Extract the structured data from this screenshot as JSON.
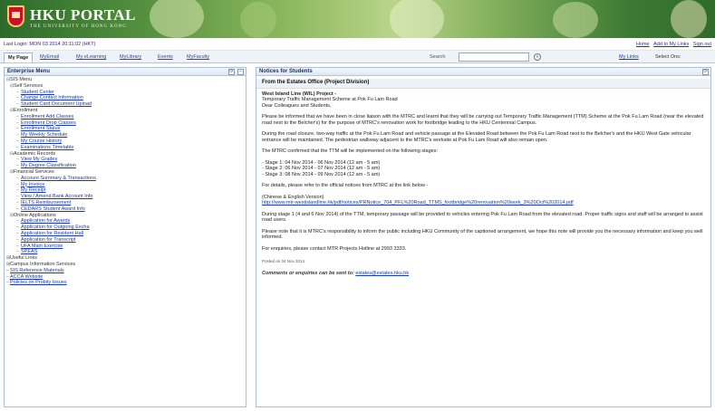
{
  "banner": {
    "title": "HKU PORTAL",
    "subtitle": "THE UNIVERSITY OF HONG KONG"
  },
  "loginbar": {
    "last_login": "Last Login: MON 03 2014 20:11:02 (HKT)",
    "links": [
      "Home",
      "Add to My Links",
      "Sign out"
    ]
  },
  "tabs": [
    "My Page",
    "MyEmail",
    "My eLearning",
    "MyLibrary",
    "Events",
    "MyFaculty"
  ],
  "search": {
    "label": "Search",
    "value": "",
    "go": "»"
  },
  "toplinks": {
    "mylinks": "My Links",
    "themes": "Select Ons:"
  },
  "left": {
    "title": "Enterprise Menu",
    "items": [
      {
        "level": 0,
        "twisty": "⊟",
        "label": "SIS Menu",
        "link": false
      },
      {
        "level": 1,
        "twisty": "⊟",
        "label": "Self Services",
        "link": false
      },
      {
        "level": 2,
        "twisty": "–",
        "label": "Student Center",
        "link": true
      },
      {
        "level": 2,
        "twisty": "–",
        "label": "Change Contact Information",
        "link": true
      },
      {
        "level": 2,
        "twisty": "–",
        "label": "Student Card Document Upload",
        "link": true
      },
      {
        "level": 1,
        "twisty": "⊟",
        "label": "Enrollment",
        "link": false
      },
      {
        "level": 2,
        "twisty": "–",
        "label": "Enrollment Add Classes",
        "link": true
      },
      {
        "level": 2,
        "twisty": "–",
        "label": "Enrollment Drop Classes",
        "link": true
      },
      {
        "level": 2,
        "twisty": "–",
        "label": "Enrollment Status",
        "link": true
      },
      {
        "level": 2,
        "twisty": "–",
        "label": "My Weekly Schedule",
        "link": true
      },
      {
        "level": 2,
        "twisty": "–",
        "label": "My Course History",
        "link": true
      },
      {
        "level": 2,
        "twisty": "–",
        "label": "Examinations Timetable",
        "link": true
      },
      {
        "level": 1,
        "twisty": "⊟",
        "label": "Academic Records",
        "link": false
      },
      {
        "level": 2,
        "twisty": "–",
        "label": "View My Grades",
        "link": true
      },
      {
        "level": 2,
        "twisty": "–",
        "label": "My Degree Classification",
        "link": true
      },
      {
        "level": 1,
        "twisty": "⊟",
        "label": "Financial Services",
        "link": false
      },
      {
        "level": 2,
        "twisty": "–",
        "label": "Account Summary & Transactions",
        "link": true
      },
      {
        "level": 2,
        "twisty": "–",
        "label": "My Invoice",
        "link": true
      },
      {
        "level": 2,
        "twisty": "–",
        "label": "My Receipt",
        "link": true
      },
      {
        "level": 2,
        "twisty": "–",
        "label": "View / Amend Bank Account Info",
        "link": true
      },
      {
        "level": 2,
        "twisty": "–",
        "label": "IELTS Reimbursement",
        "link": true
      },
      {
        "level": 2,
        "twisty": "–",
        "label": "CEDARS Student Award Info",
        "link": true
      },
      {
        "level": 1,
        "twisty": "⊟",
        "label": "Online Applications",
        "link": false
      },
      {
        "level": 2,
        "twisty": "–",
        "label": "Application for Awards",
        "link": true
      },
      {
        "level": 2,
        "twisty": "–",
        "label": "Application for Outgoing Excha",
        "link": true
      },
      {
        "level": 2,
        "twisty": "–",
        "label": "Application for Resident Hall",
        "link": true
      },
      {
        "level": 2,
        "twisty": "–",
        "label": "Application for Transcript",
        "link": true
      },
      {
        "level": 2,
        "twisty": "–",
        "label": "UFA Main Exercise",
        "link": true
      },
      {
        "level": 2,
        "twisty": "–",
        "label": "SPEAS",
        "link": true
      },
      {
        "level": 0,
        "twisty": "⊞",
        "label": "Useful Links",
        "link": false
      },
      {
        "level": 0,
        "twisty": "⊞",
        "label": "Campus Information Services",
        "link": false
      },
      {
        "level": 0,
        "twisty": "–",
        "label": "SIS Reference Materials",
        "link": true
      },
      {
        "level": 0,
        "twisty": "–",
        "label": "ACCA Website",
        "link": true
      },
      {
        "level": 0,
        "twisty": "–",
        "label": "Policies on Probity Issues",
        "link": true
      }
    ]
  },
  "right": {
    "title": "Notices for Students",
    "from": "From the Estates Office (Project Division)",
    "heading": "West Island Line (WIL) Project -",
    "subheading": "Temporary Traffic Management Scheme at Pok Fu Lam Road",
    "greeting": "Dear Colleagues and Students,",
    "para1": "Please be informed that we have been in close liaison with the MTRC and learnt that they will be carrying out Temporary Traffic Management (TTM) Scheme at the Pok Fu Lam Road (near the elevated road next to the Belcher's) for the purpose of MTRC's renovation work for footbridge leading to the HKU Centennial Campus.",
    "para2": "During the road closure, two-way traffic at the Pok Fu Lam Road and vehicle passage at the Elevated Road between the Pok Fu Lam Road next to the Belcher's and the HKU West Gate vehicular entrance will be maintained. The pedestrian walkway adjacent to the MTRC's worksite at Pok Fu Lam Road will also remain open.",
    "para3": "The MTRC confirmed that the TTM will be implemented on the following stages:",
    "stages": [
      "- Stage 1: 04 Nov 2014 - 06 Nov 2014 (12 am - 5 am)",
      "- Stage 2: 06 Nov 2014 - 07 Nov 2014 (12 am - 5 am)",
      "- Stage 3: 08 Nov 2014 - 09 Nov 2014 (12 am - 5 am)"
    ],
    "para4": "For details, please refer to the official notices from MTRC at the link below -",
    "version": "(Chinese & English Version)",
    "link": "http://www.mtr-westislandline.hk/pdf/notices/PRNotice_704_PFL%20Road_TTMS_footbridge%20renovation%20work_3%20Oct%202014.pdf",
    "para5": "During stage 1 (4 and 6 Nov 2014) of the TTM, temporary passage will be provided to vehicles entering Pok Fu Lam Road from the elevated road. Proper traffic signs and staff will be arranged to assist road users.",
    "para6": "Please note that it is MTRC's responsibility to inform the public including HKU Community of the captioned arrangement, we hope this note will provide you the necessary information and keep you well informed.",
    "para7": "For enquiries, please contact MTR Projects Hotline at 2993 3333.",
    "posted": "Posted on 04 Nov 2014",
    "closing_text": "Comments or enquiries can be sent to:",
    "closing_email": "estates@estates.hku.hk"
  }
}
